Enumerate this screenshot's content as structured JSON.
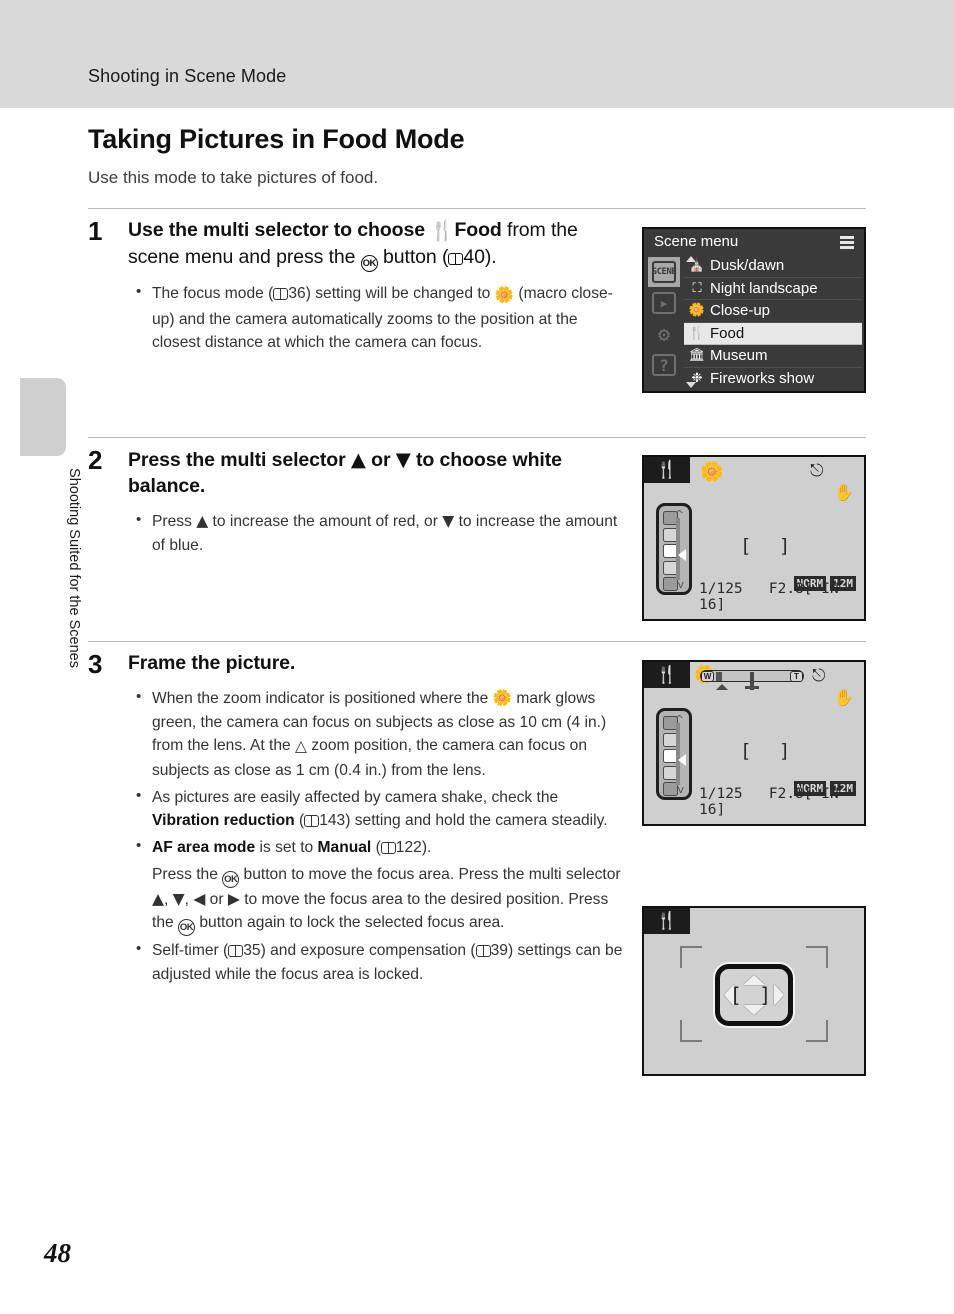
{
  "header": {
    "running_title": "Shooting in Scene Mode"
  },
  "page": {
    "title": "Taking Pictures in Food Mode",
    "subtitle": "Use this mode to take pictures of food.",
    "side_tab": "Shooting Suited for the Scenes",
    "folio": "48"
  },
  "steps": [
    {
      "number": "1",
      "head_1": "Use the multi selector to choose ",
      "head_food": "Food",
      "head_2": " from the scene menu and press the ",
      "head_3": " button (",
      "head_ref": "40",
      "head_4": ").",
      "bullets": [
        {
          "a": "The focus mode (",
          "ref": "36",
          "b": ") setting will be changed to ",
          "c": " (macro close-up) and the camera automatically zooms to the position at the closest distance at which the camera can focus."
        }
      ]
    },
    {
      "number": "2",
      "head_1": "Press the multi selector ",
      "head_2": " or ",
      "head_3": " to choose white balance.",
      "bullets": [
        {
          "a": "Press ",
          "b": " to increase the amount of red, or ",
          "c": " to increase the amount of blue."
        }
      ]
    },
    {
      "number": "3",
      "head_1": "Frame the picture.",
      "bullets": [
        {
          "a": "When the zoom indicator is positioned where the ",
          "b": " mark glows green, the camera can focus on subjects as close as 10 cm (4 in.) from the lens. At the ",
          "c": " zoom position, the camera can focus on subjects as close as 1 cm (0.4 in.) from the lens."
        },
        {
          "a": "As pictures are easily affected by camera shake, check the ",
          "bold": "Vibration reduction",
          "b": " (",
          "ref": "143",
          "c": ") setting and hold the camera steadily."
        },
        {
          "bold1": "AF area mode",
          "a": " is set to ",
          "bold2": "Manual",
          "b": " (",
          "ref": "122",
          "c": ")."
        },
        {
          "a": "Press the ",
          "b": " button to move the focus area. Press the multi selector ",
          "c": ", ",
          "d": ", ",
          "e": " or ",
          "f": " to move the focus area to the desired position. Press the ",
          "g": " button again to lock the selected focus area."
        },
        {
          "a": "Self-timer (",
          "ref1": "35",
          "b": ") and exposure compensation (",
          "ref2": "39",
          "c": ") settings can be adjusted while the focus area is locked."
        }
      ]
    }
  ],
  "scene_menu": {
    "title": "Scene menu",
    "tabs": [
      {
        "name": "scene-tab",
        "label": "SCENE",
        "active": true
      },
      {
        "name": "playback-tab",
        "label": "▶",
        "active": false
      },
      {
        "name": "setup-tab",
        "label": "⚙",
        "active": false
      },
      {
        "name": "help-tab",
        "label": "?",
        "active": false
      }
    ],
    "items": [
      {
        "icon": "dusk-dawn-icon",
        "label": "Dusk/dawn",
        "selected": false
      },
      {
        "icon": "night-landscape-icon",
        "label": "Night landscape",
        "selected": false
      },
      {
        "icon": "close-up-icon",
        "label": "Close-up",
        "selected": false
      },
      {
        "icon": "food-icon",
        "label": "Food",
        "selected": true
      },
      {
        "icon": "museum-icon",
        "label": "Museum",
        "selected": false
      },
      {
        "icon": "fireworks-icon",
        "label": "Fireworks show",
        "selected": false
      }
    ]
  },
  "display_wb": {
    "mode_icon": "food-icon",
    "macro_icon": "macro-flower-icon",
    "flash_off_icon": "flash-off-icon",
    "vr_icon": "vibration-reduction-icon",
    "shutter": "1/125",
    "aperture": "F2.8",
    "storage": "[ IN   16]",
    "quality": "NORM",
    "image_size": "12M"
  },
  "display_zoom": {
    "mode_icon": "food-icon",
    "macro_icon": "macro-flower-icon",
    "zoom_w": "W",
    "zoom_t": "T",
    "flash_off_icon": "flash-off-icon",
    "vr_icon": "vibration-reduction-icon",
    "shutter": "1/125",
    "aperture": "F2.8",
    "storage": "[ IN   16]",
    "quality": "NORM",
    "image_size": "12M"
  },
  "display_focus": {
    "mode_icon": "food-icon",
    "multi_selector_icon": "multi-selector-icon"
  },
  "colors": {
    "header_bg": "#d9d9d9",
    "lcd_bg": "#cfcfcf",
    "menu_bg": "#3a3a3a",
    "selected_row": "#e8e8e8",
    "rule": "#b9b9b9"
  }
}
